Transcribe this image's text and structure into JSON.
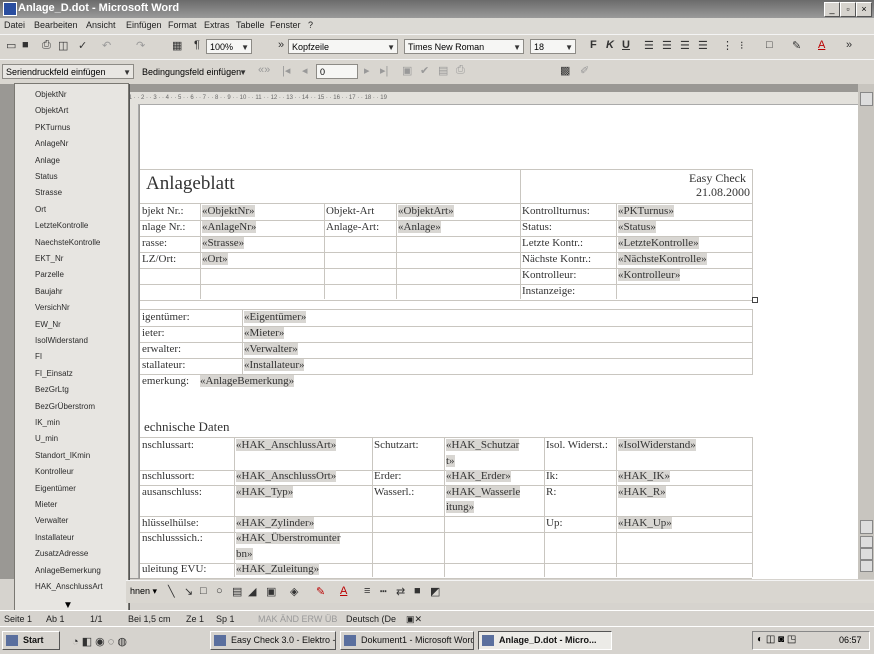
{
  "window": {
    "title": "Anlage_D.dot - Microsoft Word",
    "controls": [
      "_",
      "▫",
      "×"
    ]
  },
  "menu": [
    "Datei",
    "Bearbeiten",
    "Ansicht",
    "Einfügen",
    "Format",
    "Extras",
    "Tabelle",
    "Fenster",
    "?"
  ],
  "toolbar1": {
    "zoom": "100%",
    "style": "Kopfzeile",
    "font": "Times New Roman",
    "size": "18",
    "bold": "F",
    "italic": "K",
    "underline": "U"
  },
  "toolbar2": {
    "merge_fields": "Seriendruckfeld einfügen",
    "condition_fields": "Bedingungsfeld einfügen",
    "record": "0"
  },
  "field_list": {
    "items": [
      "ObjektNr",
      "ObjektArt",
      "PKTurnus",
      "AnlageNr",
      "Anlage",
      "Status",
      "Strasse",
      "Ort",
      "LetzteKontrolle",
      "NaechsteKontrolle",
      "EKT_Nr",
      "Parzelle",
      "Baujahr",
      "VersichNr",
      "EW_Nr",
      "IsolWiderstand",
      "FI",
      "FI_Einsatz",
      "BezGrLtg",
      "BezGrÜberstrom",
      "IK_min",
      "U_min",
      "Standort_IKmin",
      "Kontrolleur",
      "Eigentümer",
      "Mieter",
      "Verwalter",
      "Installateur",
      "ZusatzAdresse",
      "AnlageBemerkung",
      "HAK_AnschlussArt"
    ],
    "more": "▼"
  },
  "document": {
    "heading": "Anlageblatt",
    "brand": "Easy Check",
    "date": "21.08.2000",
    "rows1": [
      [
        "bjekt Nr.:",
        "«ObjektNr»",
        "Objekt-Art",
        "«ObjektArt»",
        "Kontrollturnus:",
        "«PKTurnus»"
      ],
      [
        "nlage Nr.:",
        "«AnlageNr»",
        "Anlage-Art:",
        "«Anlage»",
        "Status:",
        "«Status»"
      ],
      [
        "rasse:",
        "«Strasse»",
        "",
        "",
        "Letzte Kontr.:",
        "«LetzteKontrolle»"
      ],
      [
        "LZ/Ort:",
        "«Ort»",
        "",
        "",
        "Nächste Kontr.:",
        "«NächsteKontrolle»"
      ],
      [
        "",
        "",
        "",
        "",
        "Kontrolleur:",
        "«Kontrolleur»"
      ],
      [
        "",
        "",
        "",
        "",
        "Instanzeige:",
        ""
      ]
    ],
    "rows2": [
      [
        "igentümer:",
        "«Eigentümer»"
      ],
      [
        "ieter:",
        "«Mieter»"
      ],
      [
        "erwalter:",
        "«Verwalter»"
      ],
      [
        "stallateur:",
        "«Installateur»"
      ]
    ],
    "remark_label": "emerkung:",
    "remark_value": "«AnlageBemerkung»",
    "tech_heading": "echnische Daten",
    "rows3": [
      [
        "nschlussart:",
        "«HAK_AnschlussArt»",
        "Schutzart:",
        "«HAK_Schutzar",
        "Isol. Widerst.:",
        "«IsolWiderstand»"
      ],
      [
        "",
        "",
        "",
        "t»",
        "",
        ""
      ],
      [
        "nschlussort:",
        "«HAK_AnschlussOrt»",
        "Erder:",
        "«HAK_Erder»",
        "Ik:",
        "«HAK_IK»"
      ],
      [
        "ausanschluss:",
        "«HAK_Typ»",
        "Wasserl.:",
        "«HAK_Wasserle",
        "R:",
        "«HAK_R»"
      ],
      [
        "",
        "",
        "",
        "itung»",
        "",
        ""
      ],
      [
        "hlüsselhülse:",
        "«HAK_Zylinder»",
        "",
        "",
        "Up:",
        "«HAK_Up»"
      ],
      [
        "nschlusssich.:",
        "«HAK_Überstromunter",
        "",
        "",
        "",
        ""
      ],
      [
        "",
        "bn»",
        "",
        "",
        "",
        ""
      ],
      [
        "uleitung EVU:",
        "«HAK_Zuleitung»",
        "",
        "",
        "",
        ""
      ]
    ]
  },
  "drawbar": {
    "label": "hnen ▾"
  },
  "status": {
    "page": "Seite 1",
    "section": "Ab 1",
    "pages": "1/1",
    "position": "Bei 1,5 cm",
    "line": "Ze 1",
    "col": "Sp 1",
    "flags": "MAK  ÄND  ERW  ÜB",
    "language": "Deutsch (De"
  },
  "taskbar": {
    "start": "Start",
    "tasks": [
      "Easy Check 3.0 - Elektro -",
      "Dokument1 - Microsoft Word",
      "Anlage_D.dot - Micro..."
    ],
    "clock": "06:57"
  },
  "colors": {
    "titlebar": "#6b6b6b",
    "field_highlight": "#d8d6d2"
  }
}
